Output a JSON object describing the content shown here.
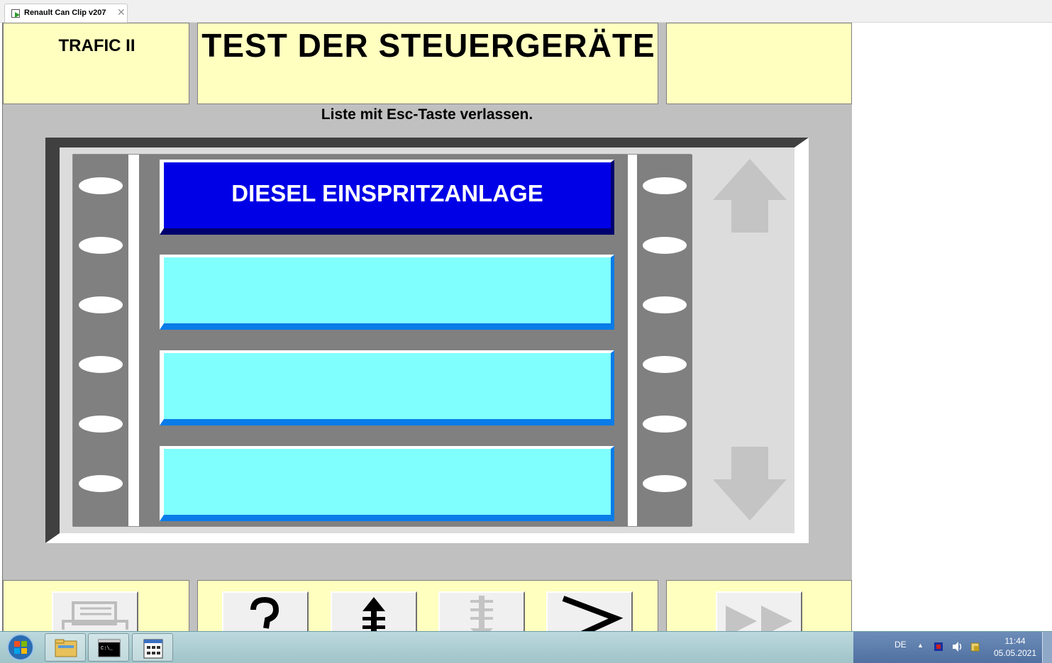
{
  "window": {
    "tab_title": "Renault Can Clip v207",
    "close_glyph": "✕"
  },
  "header": {
    "vehicle": "TRAFIC II",
    "title": "TEST DER STEUERGERÄTE"
  },
  "hint": "Liste mit Esc-Taste verlassen.",
  "list": {
    "items": [
      {
        "label": "DIESEL EINSPRITZANLAGE",
        "selected": true
      },
      {
        "label": "",
        "selected": false
      },
      {
        "label": "",
        "selected": false
      },
      {
        "label": "",
        "selected": false
      }
    ],
    "scroll_up_enabled": false,
    "scroll_down_enabled": false
  },
  "toolbar": {
    "buttons": [
      {
        "icon": "printer-icon",
        "enabled": false
      },
      {
        "icon": "help-icon",
        "enabled": true
      },
      {
        "icon": "page-up-icon",
        "enabled": true
      },
      {
        "icon": "page-down-icon",
        "enabled": false
      },
      {
        "icon": "next-icon",
        "enabled": true
      },
      {
        "icon": "fast-forward-icon",
        "enabled": false
      }
    ]
  },
  "taskbar": {
    "language": "DE",
    "time": "11:44",
    "date": "05.05.2021",
    "pinned": [
      "explorer-icon",
      "command-prompt-icon",
      "control-panel-icon"
    ]
  },
  "colors": {
    "panel_yellow": "#ffffc0",
    "app_gray": "#c0c0c0",
    "selected_item": "#0000e6",
    "item_cyan": "#80ffff"
  }
}
